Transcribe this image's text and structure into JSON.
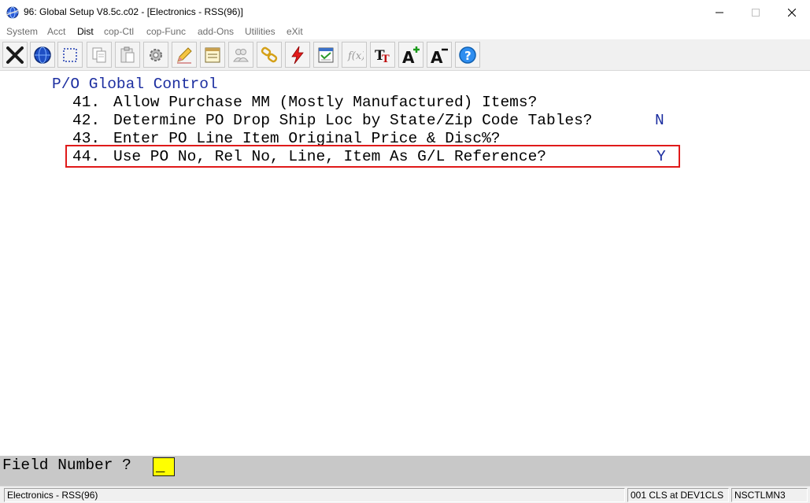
{
  "window": {
    "title": "96: Global Setup V8.5c.c02 - [Electronics - RSS(96)]",
    "icon": "globe-app-icon"
  },
  "menu": {
    "items": [
      {
        "label": "System"
      },
      {
        "label": "Acct"
      },
      {
        "label": "Dist"
      },
      {
        "label": "cop-Ctl"
      },
      {
        "label": "cop-Func"
      },
      {
        "label": "add-Ons"
      },
      {
        "label": "Utilities"
      },
      {
        "label": "eXit"
      }
    ]
  },
  "toolbar": {
    "icons": [
      "exit-x-icon",
      "globe-icon",
      "select-icon",
      "copy-icon",
      "paste-icon",
      "settings-icon",
      "edit-icon",
      "notes-icon",
      "users-icon",
      "link-icon",
      "lightning-icon",
      "calc-icon",
      "formula-icon",
      "font-icon",
      "increase-font-icon",
      "decrease-font-icon",
      "help-icon"
    ]
  },
  "screen": {
    "heading": "P/O Global Control",
    "lines": [
      {
        "number": "41.",
        "text": "Allow Purchase MM (Mostly Manufactured) Items?",
        "value": ""
      },
      {
        "number": "42.",
        "text": "Determine PO Drop Ship Loc by State/Zip Code Tables?",
        "value": "N"
      },
      {
        "number": "43.",
        "text": "Enter PO Line Item Original Price & Disc%?",
        "value": ""
      },
      {
        "number": "44.",
        "text": "Use PO No, Rel No, Line, Item As G/L Reference?",
        "value": "Y"
      }
    ]
  },
  "prompt": {
    "label": "Field Number ?",
    "value": "_"
  },
  "status": {
    "company": "Electronics - RSS(96)",
    "session": "001 CLS at DEV1CLS",
    "program": "NSCTLMN3"
  },
  "colors": {
    "heading_blue": "#1c2ea0",
    "highlight_red": "#e01a1a",
    "input_yellow": "#ffff00"
  }
}
